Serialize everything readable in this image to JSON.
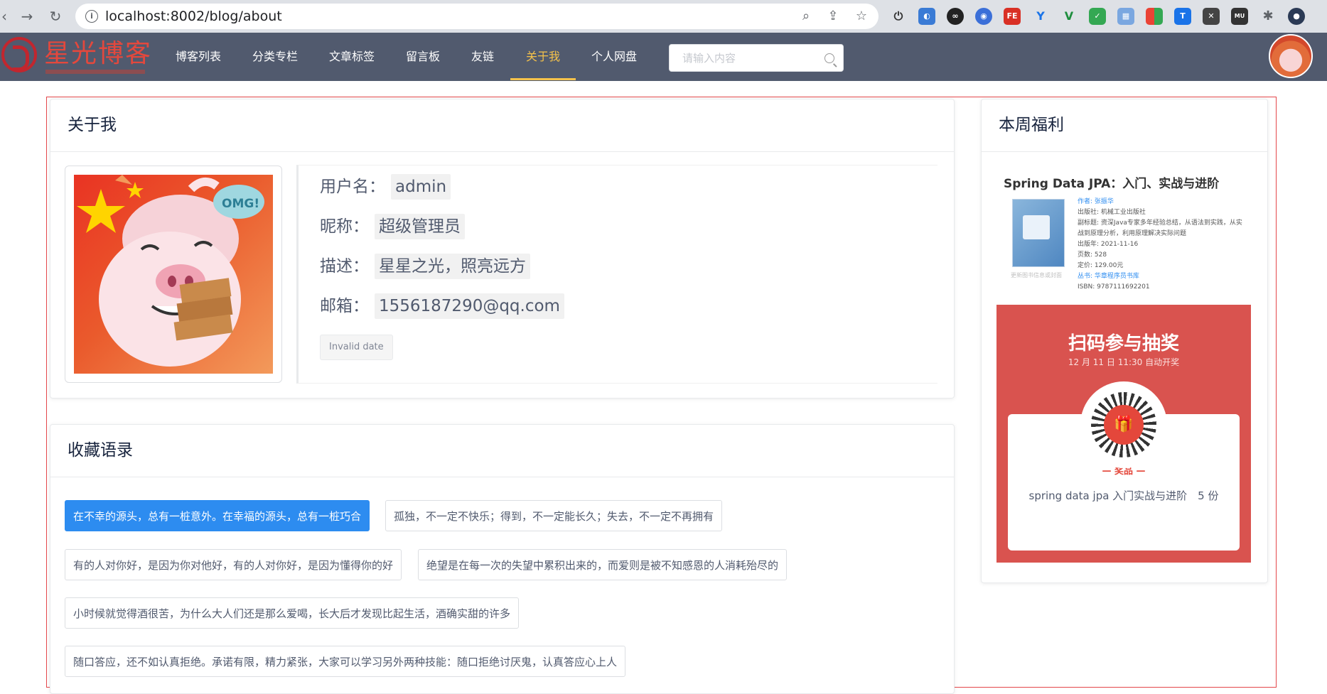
{
  "browser": {
    "url": "localhost:8002/blog/about"
  },
  "site": {
    "logo_text": "星光博客",
    "nav": [
      "博客列表",
      "分类专栏",
      "文章标签",
      "留言板",
      "友链",
      "关于我",
      "个人网盘"
    ],
    "active_nav": "关于我",
    "search_placeholder": "请输入内容"
  },
  "about": {
    "title": "关于我",
    "username_label": "用户名：",
    "username": "admin",
    "nickname_label": "昵称：",
    "nickname": "超级管理员",
    "desc_label": "描述：",
    "desc": "星星之光，照亮远方",
    "email_label": "邮箱：",
    "email": "1556187290@qq.com",
    "date": "Invalid date",
    "avatar_badge": "OMG!"
  },
  "quotes": {
    "title": "收藏语录",
    "items": [
      "在不幸的源头，总有一桩意外。在幸福的源头，总有一桩巧合",
      "孤独，不一定不快乐；得到，不一定能长久；失去，不一定不再拥有",
      "有的人对你好，是因为你对他好，有的人对你好，是因为懂得你的好",
      "绝望是在每一次的失望中累积出来的，而爱则是被不知感恩的人消耗殆尽的",
      "小时候就觉得酒很苦，为什么大人们还是那么爱喝，长大后才发现比起生活，酒确实甜的许多",
      "随口答应，还不如认真拒绝。承诺有限，精力紧张，大家可以学习另外两种技能：随口拒绝讨厌鬼，认真答应心上人"
    ]
  },
  "sidebar": {
    "title": "本周福利",
    "book": {
      "title": "Spring Data JPA：入门、实战与进阶",
      "author": "作者: 张振华",
      "publisher": "出版社: 机械工业出版社",
      "subtitle": "副标题: 资深Java专家多年经验总结，从语法到实践，从实战到原理分析，利用原理解决实际问题",
      "pubdate": "出版年: 2021-11-16",
      "pages": "页数: 528",
      "price": "定价: 129.00元",
      "series": "丛书: 华章程序员书库",
      "isbn": "ISBN: 9787111692201",
      "note": "更新图书信息或封面"
    },
    "promo": {
      "title": "扫码参与抽奖",
      "subtitle": "12 月 11 日 11:30 自动开奖",
      "prize_label": "— 奖品 —",
      "prize": "spring data jpa 入门实战与进阶　5 份"
    }
  }
}
